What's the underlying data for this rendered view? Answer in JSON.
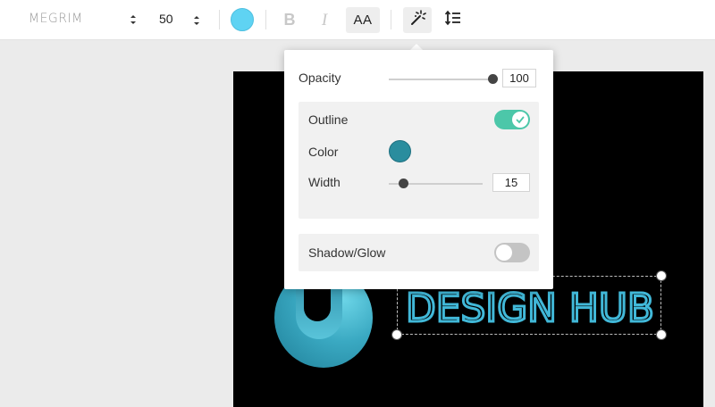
{
  "toolbar": {
    "font_name": "MEGRIM",
    "font_size": "50",
    "text_color": "#5fd3f3",
    "bold_label": "B",
    "italic_label": "I",
    "caps_label": "AA",
    "effects_icon": "magic-wand-icon",
    "spacing_icon": "line-spacing-icon"
  },
  "canvas": {
    "headline": "DESIGN HUB",
    "headline_color": "#41b8d8",
    "background": "#000000"
  },
  "effects_panel": {
    "opacity_label": "Opacity",
    "opacity_value": "100",
    "outline_label": "Outline",
    "outline_enabled": true,
    "color_label": "Color",
    "outline_color": "#2a8d9e",
    "width_label": "Width",
    "width_value": "15",
    "shadow_label": "Shadow/Glow",
    "shadow_enabled": false,
    "toggle_on_color": "#4cc7a9"
  }
}
